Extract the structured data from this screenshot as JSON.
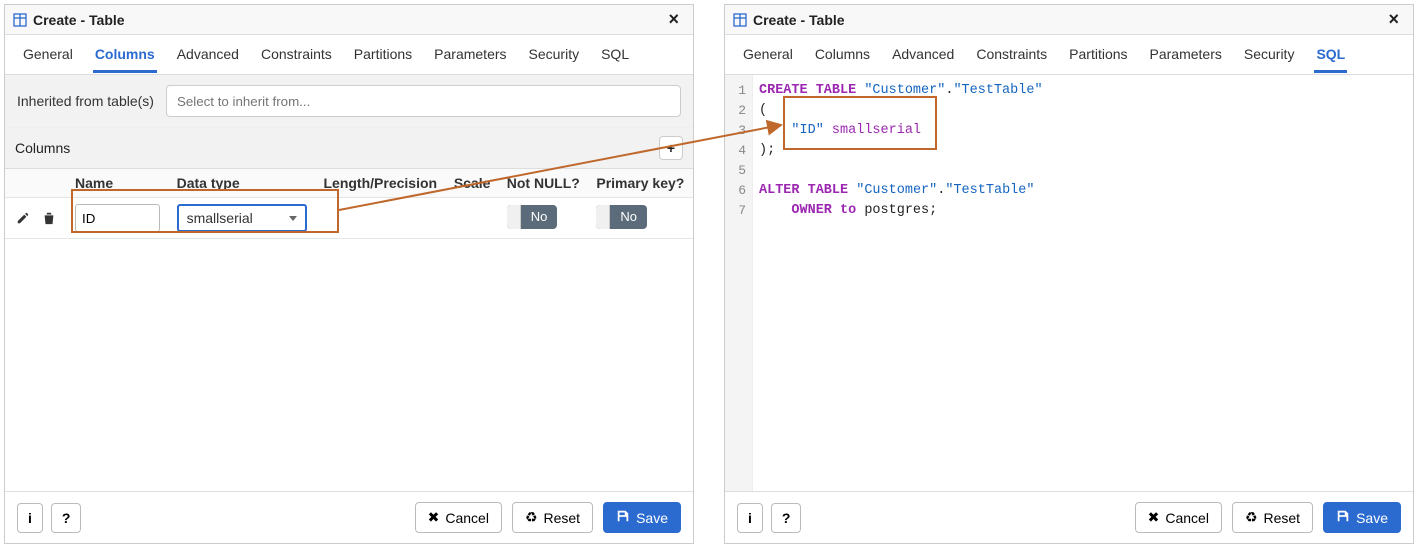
{
  "dialog_title": "Create - Table",
  "tabs": [
    "General",
    "Columns",
    "Advanced",
    "Constraints",
    "Partitions",
    "Parameters",
    "Security",
    "SQL"
  ],
  "left_active_tab": "Columns",
  "right_active_tab": "SQL",
  "inherit": {
    "label": "Inherited from table(s)",
    "placeholder": "Select to inherit from..."
  },
  "columns_section_title": "Columns",
  "columns_headers": [
    "Name",
    "Data type",
    "Length/Precision",
    "Scale",
    "Not NULL?",
    "Primary key?"
  ],
  "columns_rows": [
    {
      "name": "ID",
      "data_type": "smallserial",
      "length": "",
      "scale": "",
      "not_null": "No",
      "primary_key": "No"
    }
  ],
  "footer": {
    "info": "i",
    "help": "?",
    "cancel": "Cancel",
    "reset": "Reset",
    "save": "Save"
  },
  "sql_lines": [
    {
      "n": 1,
      "html": "<span class='kw'>CREATE TABLE</span> <span class='str'>\"Customer\"</span>.<span class='str'>\"TestTable\"</span>"
    },
    {
      "n": 2,
      "html": "("
    },
    {
      "n": 3,
      "html": "    <span class='str'>\"ID\"</span> <span class='typ'>smallserial</span>"
    },
    {
      "n": 4,
      "html": ");"
    },
    {
      "n": 5,
      "html": ""
    },
    {
      "n": 6,
      "html": "<span class='kw'>ALTER TABLE</span> <span class='str'>\"Customer\"</span>.<span class='str'>\"TestTable\"</span>"
    },
    {
      "n": 7,
      "html": "    <span class='kw'>OWNER to</span> postgres;"
    }
  ]
}
